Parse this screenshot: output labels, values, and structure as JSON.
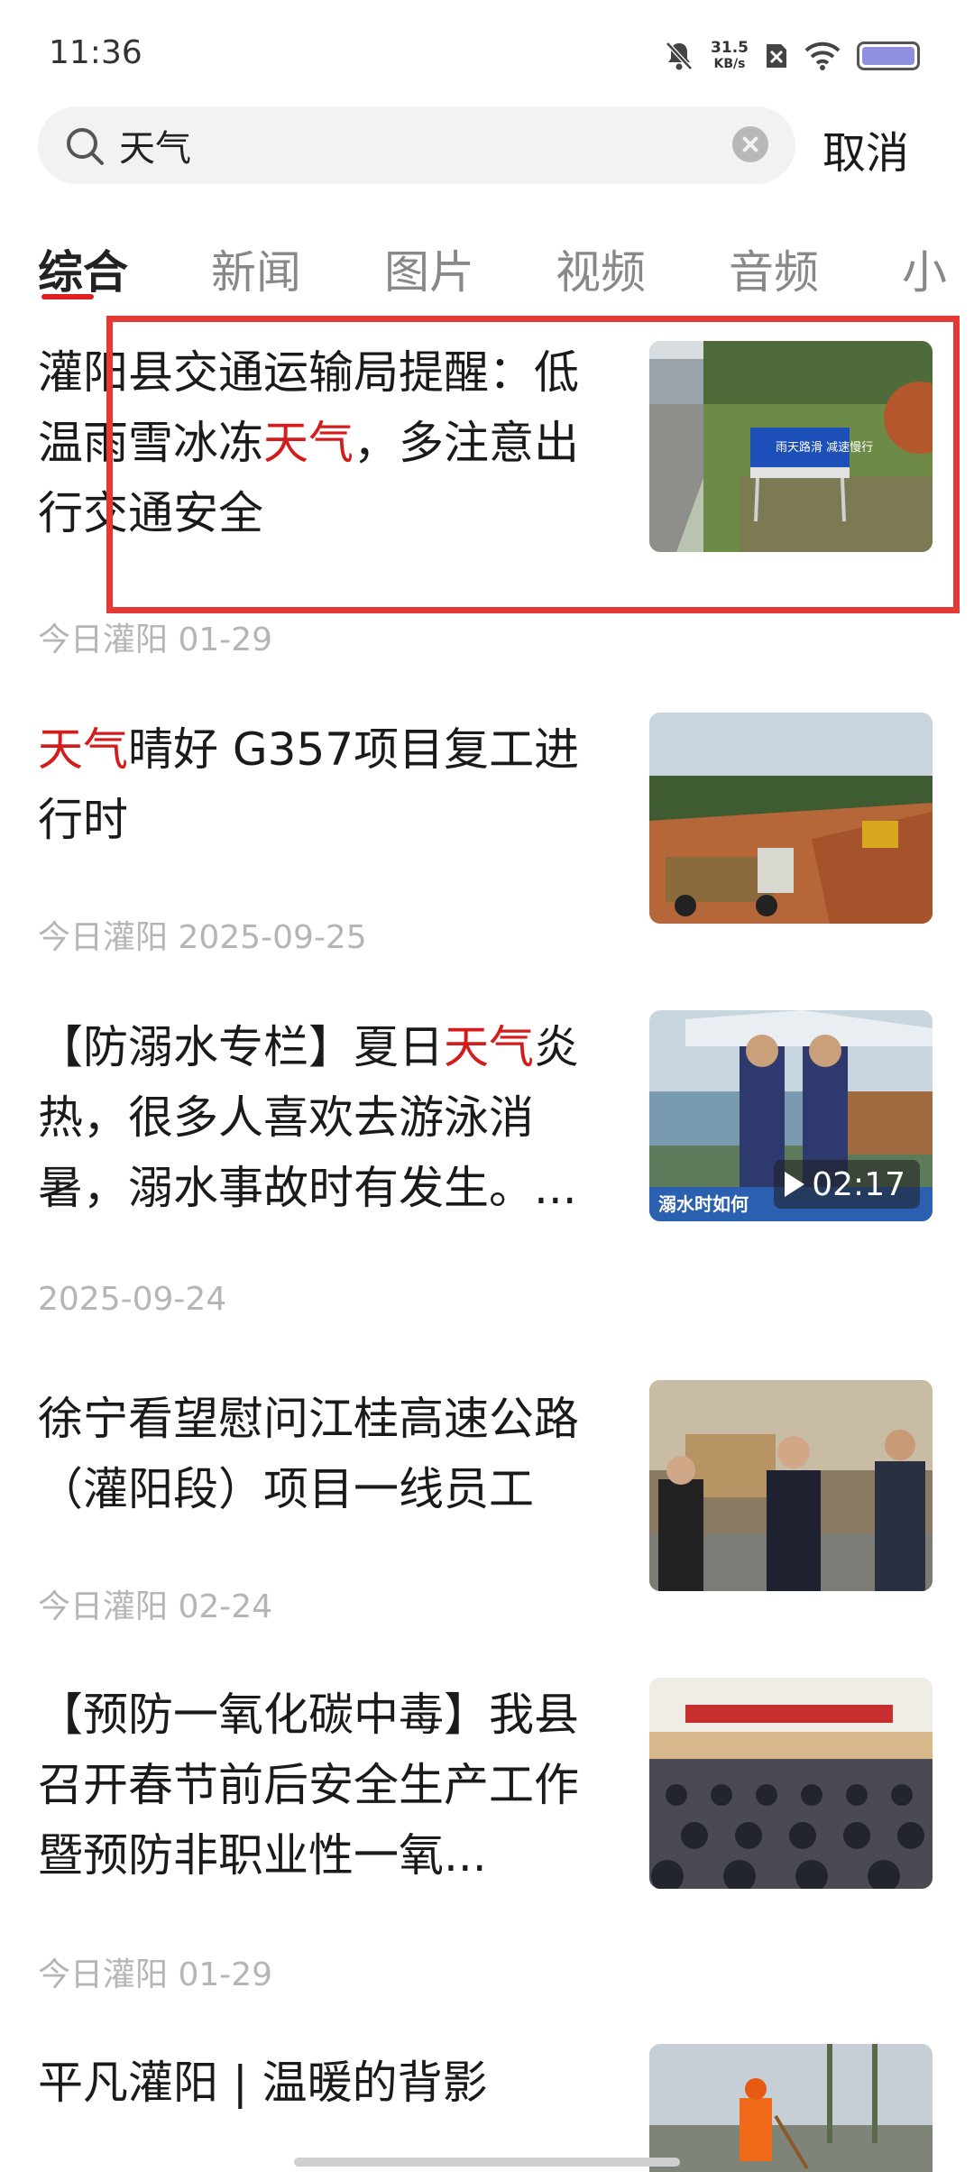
{
  "status_bar": {
    "time": "11:36",
    "net_speed_value": "31.5",
    "net_speed_unit": "KB/s"
  },
  "search": {
    "query": "天气",
    "cancel_label": "取消"
  },
  "tabs": [
    {
      "label": "综合",
      "active": true
    },
    {
      "label": "新闻"
    },
    {
      "label": "图片"
    },
    {
      "label": "视频"
    },
    {
      "label": "音频"
    },
    {
      "label": "小"
    }
  ],
  "news": [
    {
      "title_before": "灌阳县交通运输局提醒：低温雨雪冰冻",
      "title_highlight": "天气",
      "title_after": "，多注意出行交通安全",
      "source": "今日灌阳",
      "date": "01-29",
      "thumb_sign_text": "雨天路滑 减速慢行"
    },
    {
      "title_before": "",
      "title_highlight": "天气",
      "title_after": "晴好  G357项目复工进行时",
      "source": "今日灌阳",
      "date": "2025-09-25"
    },
    {
      "title_before": "【防溺水专栏】夏日",
      "title_highlight": "天气",
      "title_after": "炎热，很多人喜欢去游泳消暑，溺水事故时有发生。...",
      "source": "",
      "date": "2025-09-24",
      "video_duration": "02:17",
      "video_caption": "溺水时如何"
    },
    {
      "title_before": "徐宁看望慰问江桂高速公路（灌阳段）项目一线员工",
      "title_highlight": "",
      "title_after": "",
      "source": "今日灌阳",
      "date": "02-24"
    },
    {
      "title_before": "【预防一氧化碳中毒】我县召开春节前后安全生产工作暨预防非职业性一氧...",
      "title_highlight": "",
      "title_after": "",
      "source": "今日灌阳",
      "date": "01-29"
    },
    {
      "title_before": "平凡灌阳 | 温暖的背影",
      "title_highlight": "",
      "title_after": "",
      "source": "",
      "date": ""
    }
  ],
  "colors": {
    "highlight": "#d41c1c",
    "annotation_box": "#e53935"
  }
}
